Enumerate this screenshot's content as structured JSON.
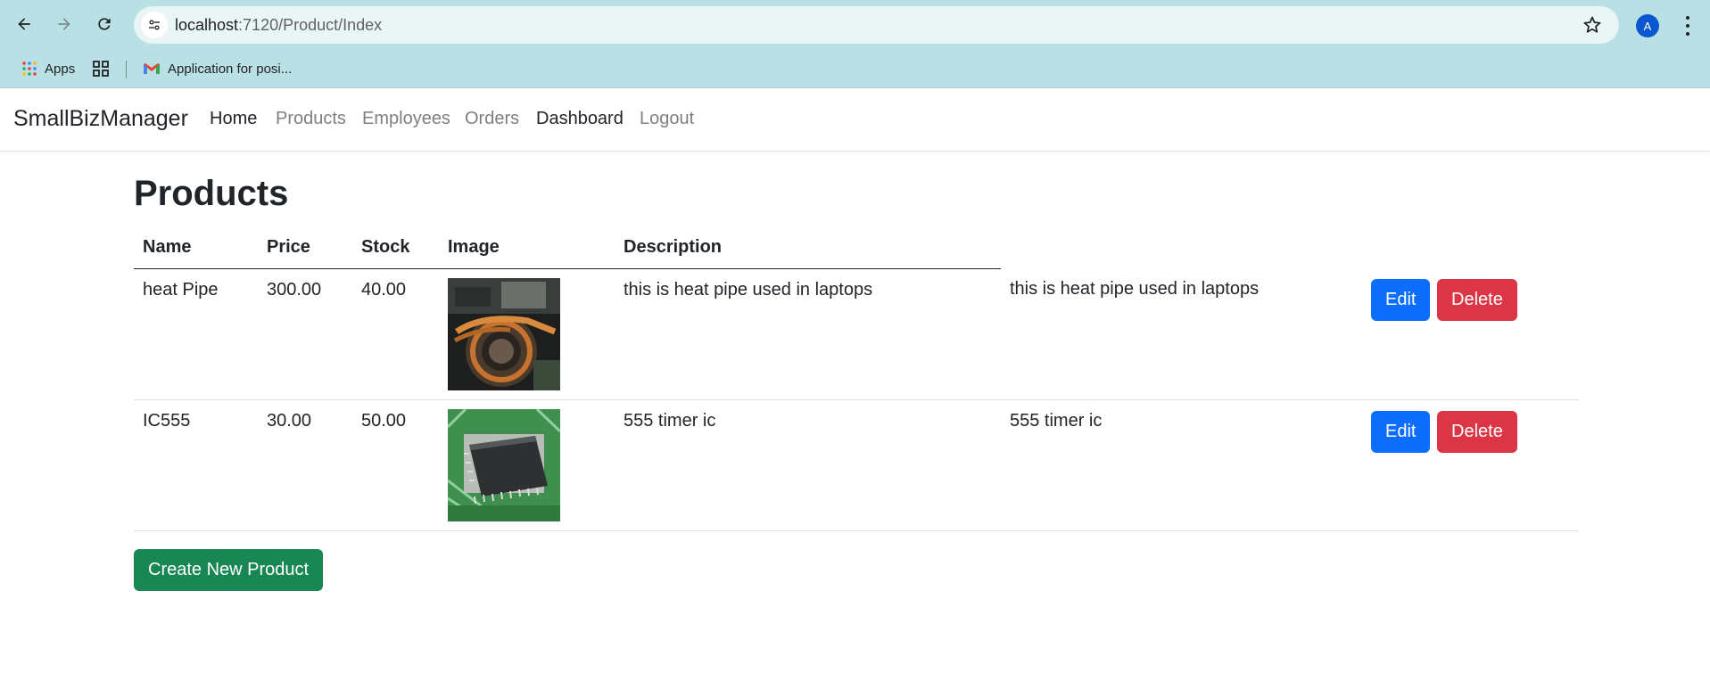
{
  "browser": {
    "url_host": "localhost",
    "url_path": ":7120/Product/Index",
    "profile_initial": "A",
    "bookmarks": [
      {
        "label": "Apps",
        "icon": "apps-grid-icon"
      },
      {
        "label": "",
        "icon": "tab-groups-icon"
      },
      {
        "label": "Application for posi...",
        "icon": "gmail-icon"
      }
    ]
  },
  "navbar": {
    "brand": "SmallBizManager",
    "links": [
      {
        "label": "Home"
      },
      {
        "label": "Products"
      },
      {
        "label": "Employees"
      },
      {
        "label": "Orders"
      },
      {
        "label": "Dashboard"
      },
      {
        "label": "Logout"
      }
    ]
  },
  "page": {
    "title": "Products",
    "columns": [
      "Name",
      "Price",
      "Stock",
      "Image",
      "Description"
    ],
    "rows": [
      {
        "name": "heat Pipe",
        "price": "300.00",
        "stock": "40.00",
        "image": "heat-pipe-photo",
        "description": "this is heat pipe used in laptops",
        "description2": "this is heat pipe used in laptops",
        "edit": "Edit",
        "delete": "Delete"
      },
      {
        "name": "IC555",
        "price": "30.00",
        "stock": "50.00",
        "image": "chip-photo",
        "description": "555 timer ic",
        "description2": "555 timer ic",
        "edit": "Edit",
        "delete": "Delete"
      }
    ],
    "create_button": "Create New Product"
  },
  "colors": {
    "chrome_bg": "#b8e0e5",
    "edit": "#0d6efd",
    "delete": "#dc3545",
    "create": "#198754"
  }
}
